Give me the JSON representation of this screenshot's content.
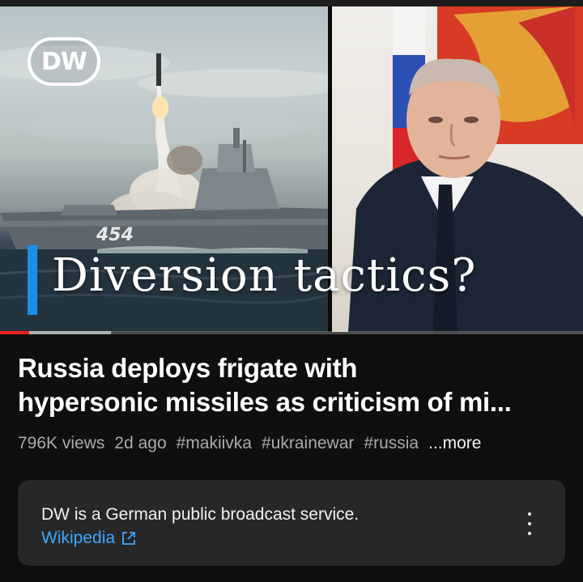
{
  "video": {
    "channel_logo_text": "DW",
    "thumbnail_caption": "Diversion tactics?",
    "ship_number": "454",
    "progress_fraction": 0.05,
    "buffered_fraction": 0.19,
    "title_line_1": "Russia deploys frigate with",
    "title_line_2": "hypersonic missiles as criticism of mi...",
    "views": "796K views",
    "age": "2d ago",
    "hashtags": [
      "#makiivka",
      "#ukrainewar",
      "#russia"
    ],
    "more_label": "...more"
  },
  "info_panel": {
    "text": "DW is a German public broadcast service.",
    "link_label": "Wikipedia",
    "menu_icon": "more-vert-icon"
  },
  "colors": {
    "background": "#0f0f0f",
    "progress": "#e52020",
    "link": "#3ea6ff",
    "caption_accent": "#1b8fe8"
  }
}
